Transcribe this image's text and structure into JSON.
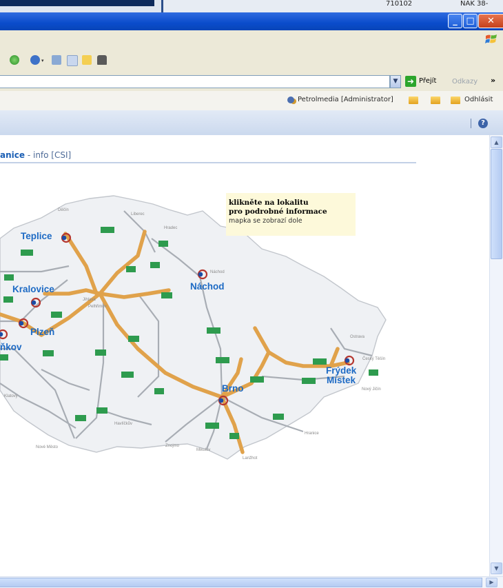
{
  "background_window": {
    "cell_id": "710102",
    "cell_nak": "NAK 38-"
  },
  "titlebar": {
    "minimize_icon": "minimize-icon",
    "maximize_icon": "maximize-icon",
    "close_icon": "close-icon"
  },
  "addressbar": {
    "go_label": "Přejít",
    "links_label": "Odkazy",
    "more_glyph": "»"
  },
  "userbar": {
    "user_label": "Petrolmedia [Administrator]",
    "logout_label": "Odhlásit"
  },
  "content": {
    "heading_main": "anice",
    "heading_sep": " - ",
    "heading_sub": "info [CSI]",
    "info_line1": "klikněte na lokalitu",
    "info_line2": "pro podrobné informace",
    "info_line3": "mapka se zobrazí dole"
  },
  "map": {
    "cities": {
      "teplice": "Teplice",
      "kralovice": "Kralovice",
      "nachod": "Náchod",
      "plzen": "Plzeň",
      "kov": "ňkov",
      "brno": "Brno",
      "frydek_1": "Frýdek",
      "frydek_2": "Místek"
    },
    "small_towns": [
      "Děčín",
      "Liberec",
      "Hradec",
      "Náchod",
      "Ostrava",
      "Český Těšín",
      "Nový Jičín",
      "Hranice",
      "Mikulov",
      "Lanžhot",
      "Znojmo",
      "Havlíčkův",
      "Jihlava",
      "Nové Město",
      "Pelhřimov",
      "Klatovy"
    ],
    "highway_labels": [
      "D8",
      "D10",
      "D11",
      "D1",
      "D5",
      "R7",
      "R6",
      "D2",
      "R35",
      "R46",
      "R48",
      "R52",
      "D3",
      "R4",
      "D1",
      "D47",
      "D35",
      "D1",
      "D56",
      "R55",
      "D2"
    ]
  },
  "colors": {
    "titlebar": "#0a4ccb",
    "highway": "#e0a24b",
    "city_text": "#1d6ac4",
    "info_box": "#fdf9da",
    "road_sign": "#2e9b4e"
  }
}
